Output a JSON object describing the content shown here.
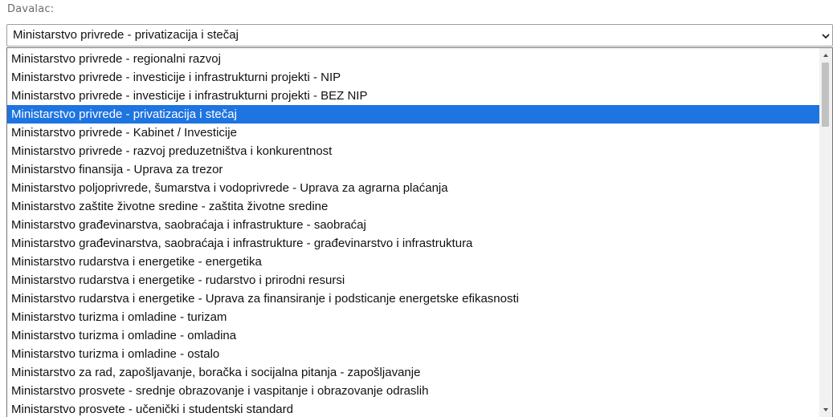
{
  "field": {
    "label": "Davalac:",
    "selected_value": "Ministarstvo privrede - privatizacija i stečaj"
  },
  "icons": {
    "select_arrow": "chevron-down-icon",
    "scroll_up": "triangle-up-icon",
    "scroll_down": "triangle-down-icon"
  },
  "colors": {
    "selected_bg": "#1e74e0",
    "selected_text": "#ffffff"
  },
  "dropdown": {
    "selected_index": 3,
    "options": [
      "Ministarstvo privrede - regionalni razvoj",
      "Ministarstvo privrede - investicije i infrastrukturni projekti - NIP",
      "Ministarstvo privrede - investicije i infrastrukturni projekti - BEZ NIP",
      "Ministarstvo privrede - privatizacija i stečaj",
      "Ministarstvo privrede - Kabinet / Investicije",
      "Ministarstvo privrede - razvoj preduzetništva i konkurentnost",
      "Ministarstvo finansija - Uprava za trezor",
      "Ministarstvo poljoprivrede, šumarstva i vodoprivrede - Uprava za agrarna plaćanja",
      "Ministarstvo zaštite životne sredine - zaštita životne sredine",
      "Ministarstvo građevinarstva, saobraćaja i infrastrukture - saobraćaj",
      "Ministarstvo građevinarstva, saobraćaja i infrastrukture - građevinarstvo i infrastruktura",
      "Ministarstvo rudarstva i energetike - energetika",
      "Ministarstvo rudarstva i energetike - rudarstvo i prirodni resursi",
      "Ministarstvo rudarstva i energetike - Uprava za finansiranje i podsticanje energetske efikasnosti",
      "Ministarstvo turizma i omladine - turizam",
      "Ministarstvo turizma i omladine - omladina",
      "Ministarstvo turizma i omladine - ostalo",
      "Ministarstvo za rad, zapošljavanje, boračka i socijalna pitanja - zapošljavanje",
      "Ministarstvo prosvete - srednje obrazovanje i vaspitanje i obrazovanje odraslih",
      "Ministarstvo prosvete - učenički i studentski standard"
    ]
  }
}
